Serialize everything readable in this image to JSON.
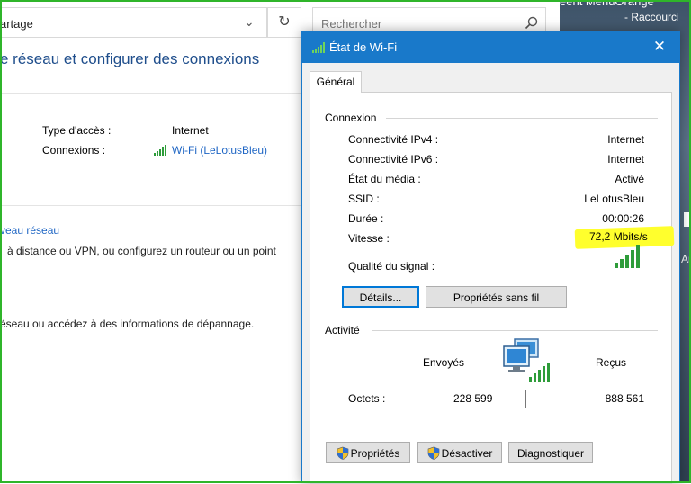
{
  "background": {
    "address_text": "artage",
    "search_placeholder": "Rechercher",
    "page_title": "e réseau et configurer des connexions",
    "access_type_label": "Type d'accès :",
    "access_type_value": "Internet",
    "connections_label": "Connexions :",
    "connections_value": "Wi-Fi (LeLotusBleu)",
    "new_network_link": "veau réseau",
    "line1": "à distance ou VPN, ou configurez un routeur ou un point",
    "line2": "éseau ou accédez à des informations de dépannage."
  },
  "desktop": {
    "text1": "eent     MenuOrange",
    "text2": "- Raccourci",
    "text3": "Ar"
  },
  "dialog": {
    "title": "État de Wi-Fi",
    "close_symbol": "✕",
    "tab_general": "Général",
    "connection_group": "Connexion",
    "rows": [
      {
        "label": "Connectivité IPv4 :",
        "value": "Internet"
      },
      {
        "label": "Connectivité IPv6 :",
        "value": "Internet"
      },
      {
        "label": "État du média :",
        "value": "Activé"
      },
      {
        "label": "SSID :",
        "value": "LeLotusBleu"
      },
      {
        "label": "Durée :",
        "value": "00:00:26"
      },
      {
        "label": "Vitesse :",
        "value": "72,2 Mbits/s"
      }
    ],
    "signal_label": "Qualité du signal :",
    "signal_bars_lit": 5,
    "details_button": "Détails...",
    "wireless_props_button": "Propriétés sans fil",
    "activity_group": "Activité",
    "sent_label": "Envoyés",
    "received_label": "Reçus",
    "bytes_label": "Octets :",
    "bytes_sent": "228 599",
    "bytes_received": "888 561",
    "properties_button": "Propriétés",
    "disable_button": "Désactiver",
    "diagnose_button": "Diagnostiquer"
  },
  "colors": {
    "frame": "#2fb52a",
    "titlebar": "#1979ca",
    "highlight": "#ffff2d",
    "link": "#1f66c4"
  }
}
